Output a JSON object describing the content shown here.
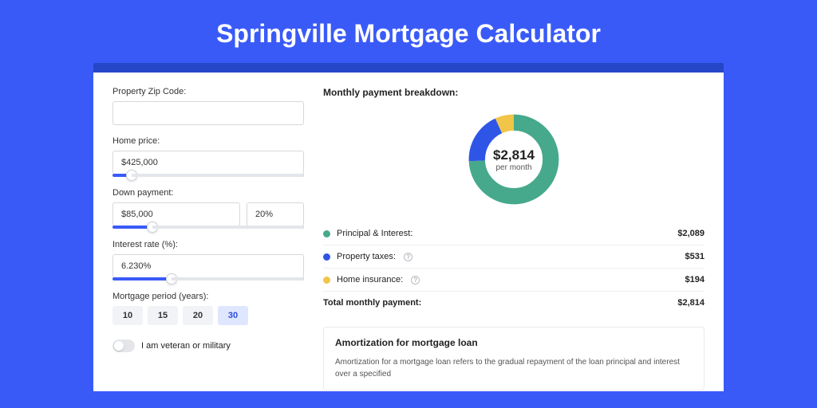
{
  "title": "Springville Mortgage Calculator",
  "form": {
    "zip_label": "Property Zip Code:",
    "zip_value": "",
    "home_price_label": "Home price:",
    "home_price_value": "$425,000",
    "home_price_slider_pos": "10%",
    "down_label": "Down payment:",
    "down_value": "$85,000",
    "down_pct": "20%",
    "down_slider_pos": "21%",
    "rate_label": "Interest rate (%):",
    "rate_value": "6.230%",
    "rate_slider_pos": "31%",
    "period_label": "Mortgage period (years):",
    "period_options": [
      "10",
      "15",
      "20",
      "30"
    ],
    "period_selected": "30",
    "veteran_label": "I am veteran or military"
  },
  "breakdown": {
    "heading": "Monthly payment breakdown:",
    "center_amount": "$2,814",
    "center_sub": "per month",
    "rows": [
      {
        "label": "Principal & Interest:",
        "amount": "$2,089",
        "color": "sw-green",
        "info": false
      },
      {
        "label": "Property taxes:",
        "amount": "$531",
        "color": "sw-blue",
        "info": true
      },
      {
        "label": "Home insurance:",
        "amount": "$194",
        "color": "sw-yellow",
        "info": true
      }
    ],
    "total_label": "Total monthly payment:",
    "total_amount": "$2,814"
  },
  "amortization": {
    "title": "Amortization for mortgage loan",
    "body": "Amortization for a mortgage loan refers to the gradual repayment of the loan principal and interest over a specified"
  },
  "chart_data": {
    "type": "pie",
    "title": "Monthly payment breakdown",
    "series": [
      {
        "name": "Principal & Interest",
        "value": 2089,
        "color": "#46a98b"
      },
      {
        "name": "Property taxes",
        "value": 531,
        "color": "#2f55e6"
      },
      {
        "name": "Home insurance",
        "value": 194,
        "color": "#f0c548"
      }
    ],
    "total": 2814,
    "center_label": "$2,814 per month"
  }
}
